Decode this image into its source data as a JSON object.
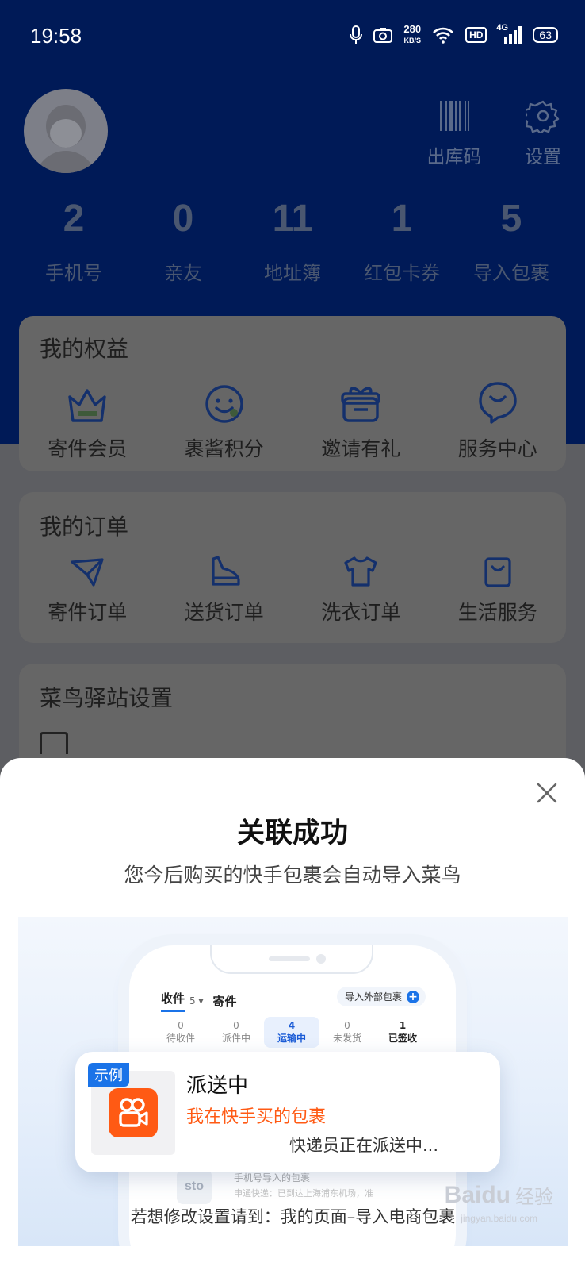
{
  "status_bar": {
    "time": "19:58",
    "speed_value": "280",
    "speed_unit": "KB/S",
    "hd": "HD",
    "network": "4G",
    "battery": "63"
  },
  "header": {
    "actions": [
      {
        "label": "出库码",
        "icon": "barcode-icon"
      },
      {
        "label": "设置",
        "icon": "gear-icon"
      }
    ],
    "stats": [
      {
        "value": "2",
        "label": "手机号"
      },
      {
        "value": "0",
        "label": "亲友"
      },
      {
        "value": "11",
        "label": "地址簿"
      },
      {
        "value": "1",
        "label": "红包卡券"
      },
      {
        "value": "5",
        "label": "导入包裹"
      }
    ]
  },
  "benefits": {
    "title": "我的权益",
    "items": [
      {
        "label": "寄件会员",
        "icon": "crown-icon"
      },
      {
        "label": "裹酱积分",
        "icon": "smiley-icon"
      },
      {
        "label": "邀请有礼",
        "icon": "gift-icon"
      },
      {
        "label": "服务中心",
        "icon": "support-icon"
      }
    ]
  },
  "orders": {
    "title": "我的订单",
    "items": [
      {
        "label": "寄件订单",
        "icon": "paper-plane-icon"
      },
      {
        "label": "送货订单",
        "icon": "boot-icon"
      },
      {
        "label": "洗衣订单",
        "icon": "tshirt-icon"
      },
      {
        "label": "生活服务",
        "icon": "bag-icon"
      }
    ]
  },
  "station": {
    "title": "菜鸟驿站设置"
  },
  "sheet": {
    "title": "关联成功",
    "subtitle": "您今后购买的快手包裹会自动导入菜鸟",
    "phone": {
      "tab_receive": "收件",
      "tab_receive_count": "5",
      "tab_send": "寄件",
      "import_label": "导入外部包裹",
      "statuses": [
        {
          "count": "0",
          "label": "待收件"
        },
        {
          "count": "0",
          "label": "派件中"
        },
        {
          "count": "4",
          "label": "运输中"
        },
        {
          "count": "0",
          "label": "未发货"
        },
        {
          "count": "1",
          "label": "已签收"
        }
      ],
      "bottom_title": "手机号导入的包裹",
      "bottom_detail": "申通快递：已到达上海浦东机场，准",
      "carrier_logo": "sto"
    },
    "notice": {
      "tag": "示例",
      "title": "派送中",
      "package": "我在快手买的包裹",
      "status": "快递员正在派送中..."
    },
    "footer": "若想修改设置请到：我的页面–导入电商包裹"
  },
  "watermark": {
    "brand": "Baidu",
    "suffix": "经验",
    "url": "jingyan.baidu.com"
  },
  "colors": {
    "brand_blue": "#1a73e8",
    "kuaishou_orange": "#ff5a14",
    "header_bg": "#001a57"
  }
}
